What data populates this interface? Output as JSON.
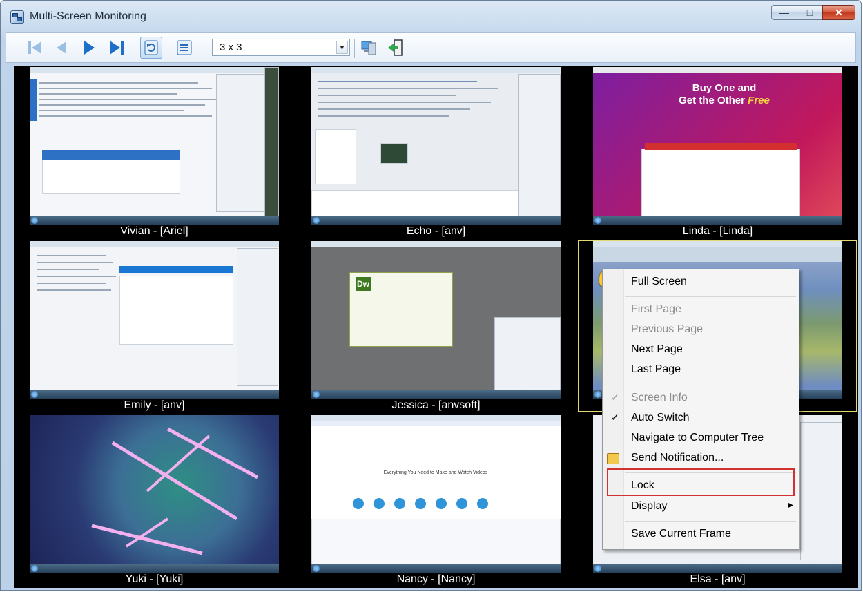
{
  "window": {
    "title": "Multi-Screen Monitoring"
  },
  "toolbar": {
    "buttons": [
      "first-page",
      "previous-page",
      "next-page",
      "last-page",
      "auto-switch",
      "screen-info",
      "computer-tree",
      "exit"
    ],
    "layout_value": "3 x 3"
  },
  "screens": [
    {
      "caption": "Vivian - [Ariel]"
    },
    {
      "caption": "Echo - [anv]"
    },
    {
      "caption": "Linda - [Linda]"
    },
    {
      "caption": "Emily - [anv]"
    },
    {
      "caption": "Jessica - [anvsoft]"
    },
    {
      "caption": ""
    },
    {
      "caption": "Yuki - [Yuki]"
    },
    {
      "caption": "Nancy - [Nancy]"
    },
    {
      "caption": "Elsa - [anv]"
    }
  ],
  "screen_text": {
    "linda_ad_line1": "Buy One and",
    "linda_ad_line2": "Get the Other",
    "linda_ad_free": "Free",
    "jessica_dw": "Dw",
    "nancy_headline": "Everything You Need to Make and Watch Videos"
  },
  "context_menu": {
    "items": {
      "full_screen": "Full Screen",
      "first_page": "First Page",
      "previous_page": "Previous Page",
      "next_page": "Next Page",
      "last_page": "Last Page",
      "screen_info": "Screen Info",
      "auto_switch": "Auto Switch",
      "navigate_tree": "Navigate to Computer Tree",
      "send_notification": "Send Notification...",
      "lock": "Lock",
      "display": "Display",
      "save_frame": "Save Current Frame"
    },
    "highlighted": "Lock",
    "highlight_color": "#d1312f"
  }
}
